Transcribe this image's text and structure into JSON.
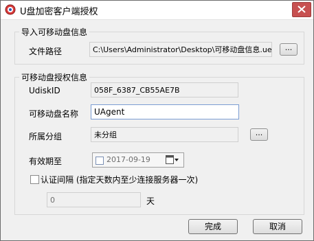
{
  "window": {
    "title": "U盘加密客户端授权"
  },
  "import_group": {
    "title": "导入可移动盘信息",
    "file_path_label": "文件路径",
    "file_path_value": "C:\\Users\\Administrator\\Desktop\\可移动盘信息.uea",
    "browse_label": "..."
  },
  "auth_group": {
    "title": "可移动盘授权信息",
    "udisk_id_label": "UdiskID",
    "udisk_id_value": "058F_6387_CB55AE7B",
    "name_label": "可移动盘名称",
    "name_value": "UAgent",
    "group_label": "所属分组",
    "group_value": "未分组",
    "group_browse_label": "...",
    "expiry_label": "有效期至",
    "expiry_value": "2017-09-19",
    "interval_checkbox_label": "认证间隔 (指定天数内至少连接服务器一次)",
    "interval_value": "0",
    "interval_unit": "天"
  },
  "buttons": {
    "ok_label": "完成",
    "cancel_label": "取消"
  },
  "colors": {
    "close_button": "#c75050",
    "input_border": "#7a9cd3"
  }
}
